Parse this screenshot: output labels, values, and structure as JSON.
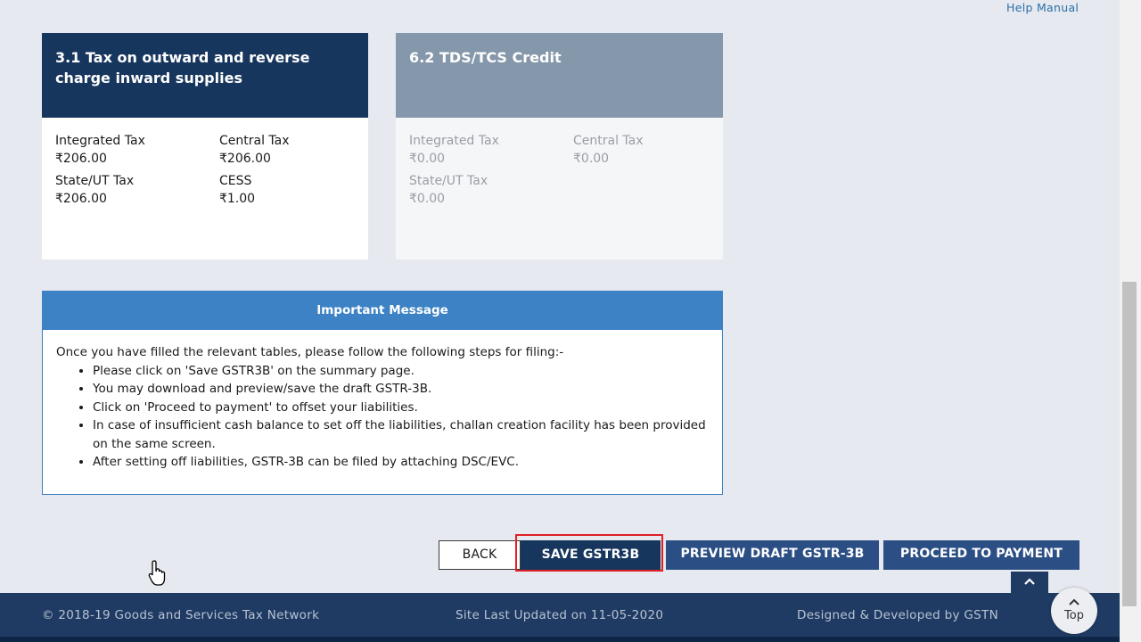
{
  "header": {
    "help_manual": "Help Manual"
  },
  "cards": [
    {
      "title": "3.1 Tax on outward and reverse charge inward supplies",
      "fields": [
        {
          "label": "Integrated Tax",
          "value": "₹206.00"
        },
        {
          "label": "Central Tax",
          "value": "₹206.00"
        },
        {
          "label": "State/UT Tax",
          "value": "₹206.00"
        },
        {
          "label": "CESS",
          "value": "₹1.00"
        }
      ]
    },
    {
      "title": "6.2 TDS/TCS Credit",
      "fields": [
        {
          "label": "Integrated Tax",
          "value": "₹0.00"
        },
        {
          "label": "Central Tax",
          "value": "₹0.00"
        },
        {
          "label": "State/UT Tax",
          "value": "₹0.00"
        }
      ]
    }
  ],
  "message": {
    "title": "Important Message",
    "intro": "Once you have filled the relevant tables, please follow the following steps for filing:-",
    "steps": [
      "Please click on 'Save GSTR3B' on the summary page.",
      "You may download and preview/save the draft GSTR-3B.",
      "Click on 'Proceed to payment' to offset your liabilities.",
      "In case of insufficient cash balance to set off the liabilities, challan creation facility has been provided on the same screen.",
      "After setting off liabilities, GSTR-3B can be filed by attaching DSC/EVC."
    ]
  },
  "buttons": {
    "back": "BACK",
    "save": "SAVE GSTR3B",
    "preview": "PREVIEW DRAFT GSTR-3B",
    "proceed": "PROCEED TO PAYMENT"
  },
  "footer": {
    "copyright": "© 2018-19 Goods and Services Tax Network",
    "updated": "Site Last Updated on 11-05-2020",
    "credits": "Designed & Developed by GSTN"
  },
  "top_button": {
    "label": "Top",
    "icon": "chevron-up-icon"
  },
  "colors": {
    "primary_dark": "#17365d",
    "accent_blue": "#3c82c4",
    "highlight_red": "#e01f26"
  }
}
